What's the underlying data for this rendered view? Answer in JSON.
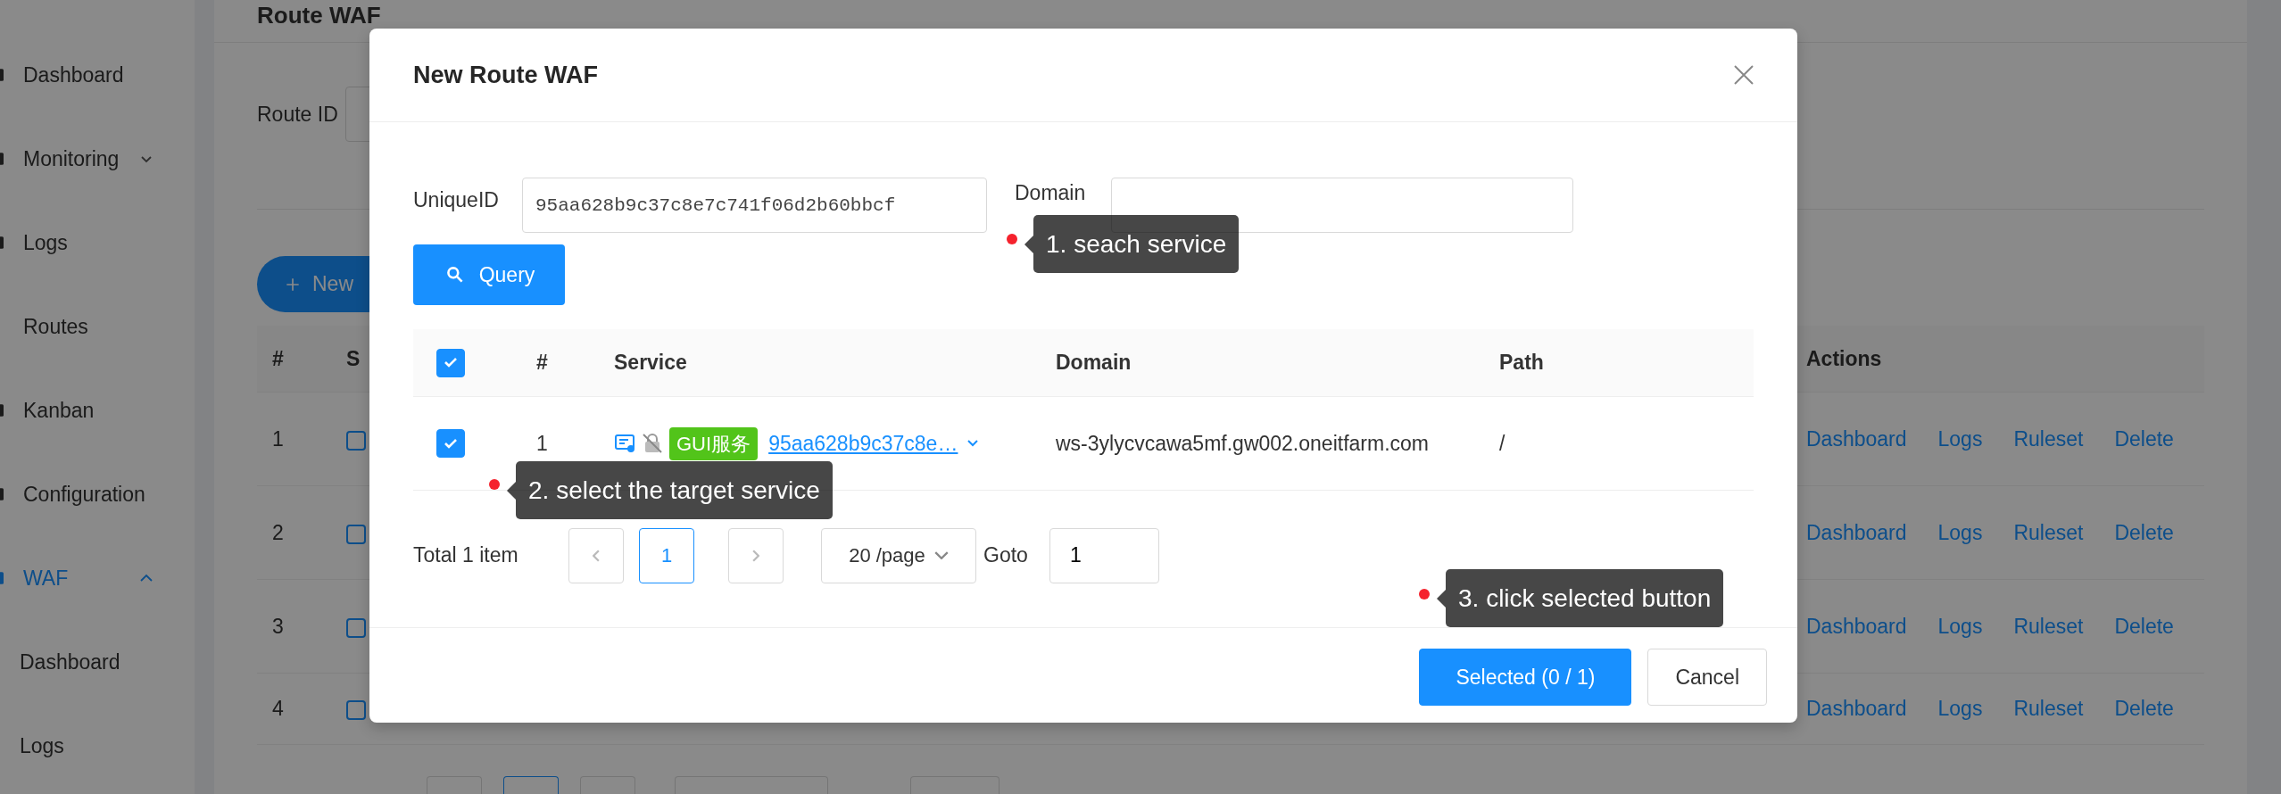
{
  "sidebar": {
    "items": [
      {
        "label": "Dashboard",
        "kind": "icon-item",
        "selected": false
      },
      {
        "label": "Monitoring",
        "kind": "group",
        "expanded": false,
        "selected": false
      },
      {
        "label": "Logs",
        "kind": "icon-item",
        "selected": false
      },
      {
        "label": "Routes",
        "kind": "plain",
        "selected": false
      },
      {
        "label": "Kanban",
        "kind": "icon-item",
        "selected": false
      },
      {
        "label": "Configuration",
        "kind": "icon-item",
        "selected": false
      },
      {
        "label": "WAF",
        "kind": "group",
        "expanded": true,
        "selected": true,
        "children": [
          {
            "label": "Dashboard",
            "selected": false
          },
          {
            "label": "Logs",
            "selected": false
          }
        ]
      }
    ]
  },
  "page": {
    "title": "Route WAF",
    "filter_label": "Route ID",
    "new_button": "New",
    "table": {
      "columns": [
        "#",
        "S",
        "Actions"
      ],
      "rows": [
        {
          "index": "1",
          "actions": [
            "Dashboard",
            "Logs",
            "Ruleset",
            "Delete"
          ]
        },
        {
          "index": "2",
          "actions": [
            "Dashboard",
            "Logs",
            "Ruleset",
            "Delete"
          ]
        },
        {
          "index": "3",
          "actions": [
            "Dashboard",
            "Logs",
            "Ruleset",
            "Delete"
          ]
        },
        {
          "index": "4",
          "actions": [
            "Dashboard",
            "Logs",
            "Ruleset",
            "Delete"
          ]
        }
      ]
    }
  },
  "modal": {
    "title": "New Route WAF",
    "fields": [
      {
        "label": "UniqueID",
        "value": "95aa628b9c37c8e7c741f06d2b60bbcf"
      },
      {
        "label": "Domain"
      }
    ],
    "query_button": "Query",
    "table": {
      "all_checked": true,
      "columns": [
        "#",
        "Service",
        "Domain",
        "Path"
      ],
      "rows": [
        {
          "checked": true,
          "index": "1",
          "tag": "GUI服务",
          "service": "95aa628b9c37c8e…",
          "domain": "ws-3ylycvcawa5mf.gw002.oneitfarm.com",
          "path": "/"
        }
      ]
    },
    "pagination": {
      "total": "Total 1 item",
      "pages": [
        {
          "label": "1",
          "selected": true
        }
      ],
      "page_size": "20 /page",
      "goto_label": "Goto",
      "goto_value": "1"
    },
    "buttons": [
      {
        "label": "Selected (0 / 1)",
        "kind": "primary"
      },
      {
        "label": "Cancel",
        "kind": "default"
      }
    ]
  },
  "tooltips": [
    {
      "text": "1. seach service"
    },
    {
      "text": "2. select the target service"
    },
    {
      "text": "3. click selected button"
    }
  ]
}
